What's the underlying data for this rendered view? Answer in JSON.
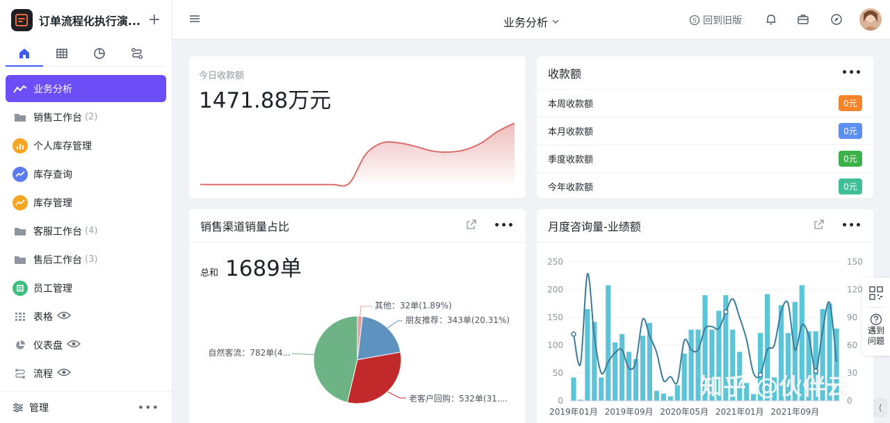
{
  "app": {
    "title": "订单流程化执行演..."
  },
  "sidebar": {
    "tabs": [
      {
        "icon": "home-icon"
      },
      {
        "icon": "table-icon"
      },
      {
        "icon": "pie-chart-icon"
      },
      {
        "icon": "flow-icon"
      }
    ],
    "items": [
      {
        "label": "业务分析",
        "count": "",
        "icon": "trend-icon",
        "active": true
      },
      {
        "label": "销售工作台",
        "count": "(2)",
        "icon": "folder-icon"
      },
      {
        "label": "个人库存管理",
        "count": "",
        "icon": "bar-chart-icon",
        "color": "#f5a623"
      },
      {
        "label": "库存查询",
        "count": "",
        "icon": "trend-icon",
        "color": "#5b7bf0"
      },
      {
        "label": "库存管理",
        "count": "",
        "icon": "trend-icon",
        "color": "#f5a623"
      },
      {
        "label": "客服工作台",
        "count": "(4)",
        "icon": "folder-icon"
      },
      {
        "label": "售后工作台",
        "count": "(3)",
        "icon": "folder-icon"
      },
      {
        "label": "员工管理",
        "count": "",
        "icon": "form-icon",
        "color": "#3dbf7f"
      },
      {
        "label": "表格",
        "count": "",
        "icon": "grid-icon",
        "eye": true
      },
      {
        "label": "仪表盘",
        "count": "",
        "icon": "pie-icon",
        "eye": true
      },
      {
        "label": "流程",
        "count": "",
        "icon": "flow-icon",
        "eye": true
      }
    ],
    "footer": {
      "label": "管理"
    }
  },
  "topbar": {
    "page_title": "业务分析",
    "old_version": "回到旧版"
  },
  "today": {
    "label": "今日收款额",
    "value": "1471.88万元"
  },
  "receipts": {
    "title": "收款额",
    "rows": [
      {
        "label": "本周收款额",
        "value": "0元",
        "color": "#f5832a"
      },
      {
        "label": "本月收款额",
        "value": "0元",
        "color": "#5b8ff0"
      },
      {
        "label": "季度收款额",
        "value": "0元",
        "color": "#3cb34a"
      },
      {
        "label": "今年收款额",
        "value": "0元",
        "color": "#3fbf96"
      }
    ]
  },
  "channels": {
    "title": "销售渠道销量占比",
    "total_label": "总和",
    "total_value": "1689单"
  },
  "monthly": {
    "title": "月度咨询量-业绩额"
  },
  "float_panel": {
    "help_line1": "遇到",
    "help_line2": "问题"
  },
  "watermark": "知乎 @伙伴云",
  "chart_data": [
    {
      "type": "area",
      "title": "",
      "x": [
        0,
        1,
        2,
        3,
        4,
        5,
        6,
        7,
        8,
        9,
        10,
        11,
        12,
        13,
        14,
        15,
        16,
        17,
        18,
        19
      ],
      "values": [
        2,
        2,
        2,
        2,
        2,
        2,
        2,
        2,
        2,
        3,
        28,
        38,
        38,
        35,
        31,
        30,
        32,
        38,
        48,
        55
      ],
      "color": "#d96b6b"
    },
    {
      "type": "pie",
      "title": "",
      "labels": [
        "其他：32单(1.89%)",
        "朋友推荐：343单(20.31%)",
        "老客户回购：532单(31....",
        "自然客流：782单(4..."
      ],
      "values": [
        32,
        343,
        532,
        782
      ],
      "colors": [
        "#e0a0a0",
        "#5e93bf",
        "#c2292b",
        "#6db385"
      ]
    },
    {
      "type": "bar",
      "title": "",
      "y_left_ticks": [
        "250",
        "200",
        "150",
        "100",
        "50",
        "0"
      ],
      "y_right_ticks": [
        "150",
        "120",
        "90",
        "60",
        "30",
        "0"
      ],
      "x_tick_labels": [
        "2019年01月",
        "2019年09月",
        "2020年05月",
        "2021年01月",
        "2021年09月"
      ],
      "ylim": [
        0,
        250
      ],
      "y2lim": [
        0,
        150
      ],
      "bars": [
        42,
        2,
        165,
        142,
        42,
        208,
        105,
        120,
        88,
        75,
        117,
        140,
        18,
        13,
        8,
        28,
        85,
        128,
        128,
        190,
        128,
        162,
        190,
        128,
        88,
        32,
        12,
        122,
        192,
        42,
        172,
        122,
        178,
        208,
        125,
        125,
        165,
        175,
        130
      ],
      "line": [
        72,
        40,
        137,
        70,
        30,
        42,
        52,
        55,
        35,
        42,
        88,
        70,
        52,
        22,
        26,
        20,
        65,
        55,
        55,
        78,
        80,
        78,
        96,
        110,
        90,
        66,
        30,
        28,
        55,
        60,
        96,
        105,
        55,
        82,
        70,
        32,
        76,
        106,
        42
      ],
      "bar_color": "#5bc4d8",
      "line_color": "#3a7a99"
    }
  ]
}
